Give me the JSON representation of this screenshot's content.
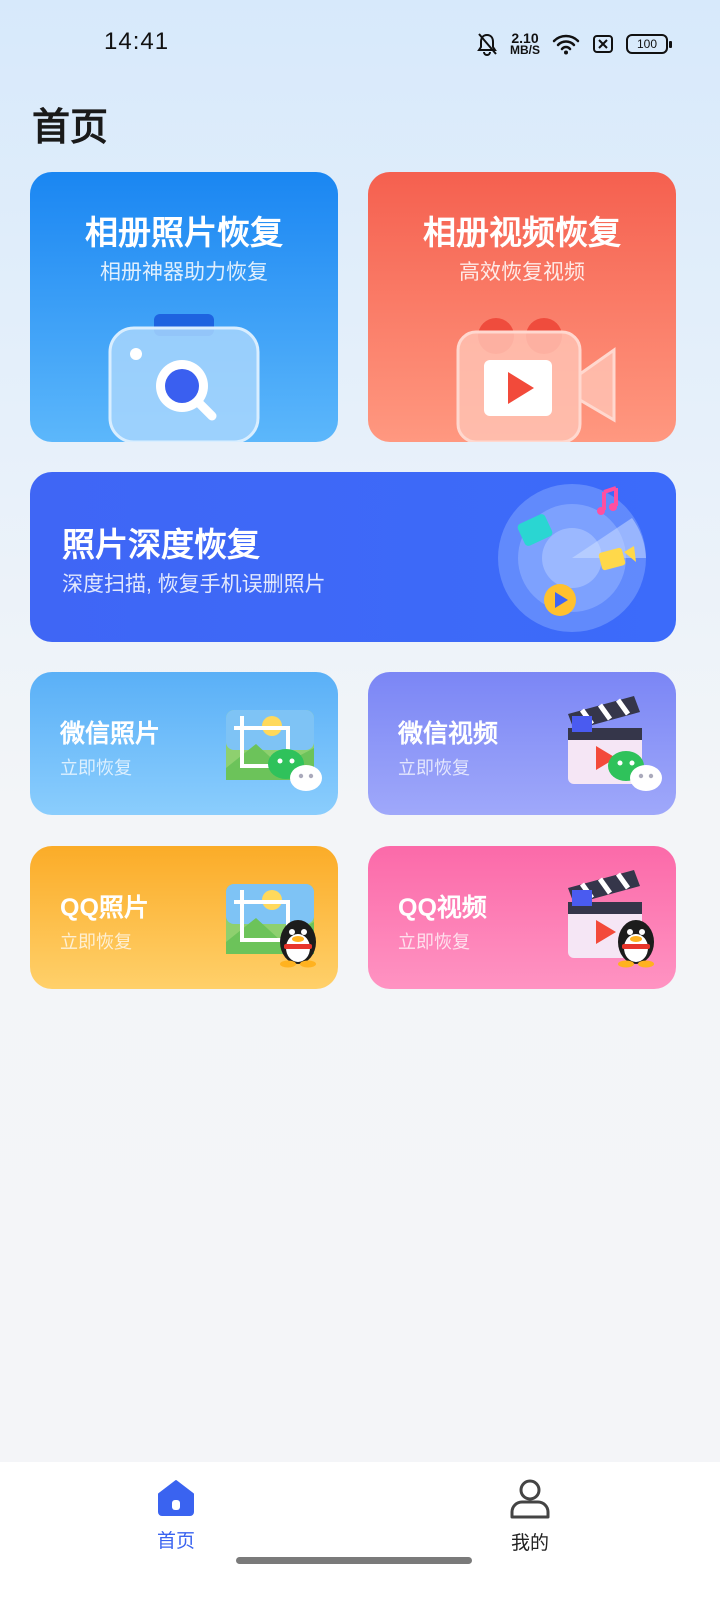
{
  "status_bar": {
    "time": "14:41",
    "net_speed_value": "2.10",
    "net_speed_unit": "MB/S",
    "battery": "100"
  },
  "page_title": "首页",
  "cards": {
    "album_photo": {
      "title": "相册照片恢复",
      "subtitle": "相册神器助力恢复",
      "icon": "camera-search-icon",
      "color": "#1a86f2"
    },
    "album_video": {
      "title": "相册视频恢复",
      "subtitle": "高效恢复视频",
      "icon": "video-camera-icon",
      "color": "#f5604f"
    },
    "deep": {
      "title": "照片深度恢复",
      "subtitle": "深度扫描, 恢复手机误删照片",
      "icon": "radar-scan-icon",
      "color": "#3f66f5"
    },
    "wx_photo": {
      "title": "微信照片",
      "subtitle": "立即恢复",
      "icon": "wechat-photo-icon"
    },
    "wx_video": {
      "title": "微信视频",
      "subtitle": "立即恢复",
      "icon": "wechat-video-icon"
    },
    "qq_photo": {
      "title": "QQ照片",
      "subtitle": "立即恢复",
      "icon": "qq-photo-icon"
    },
    "qq_video": {
      "title": "QQ视频",
      "subtitle": "立即恢复",
      "icon": "qq-video-icon"
    }
  },
  "tabbar": {
    "home": {
      "label": "首页",
      "icon": "home-icon",
      "active": true,
      "color": "#3a63f0"
    },
    "mine": {
      "label": "我的",
      "icon": "user-icon",
      "active": false
    }
  }
}
